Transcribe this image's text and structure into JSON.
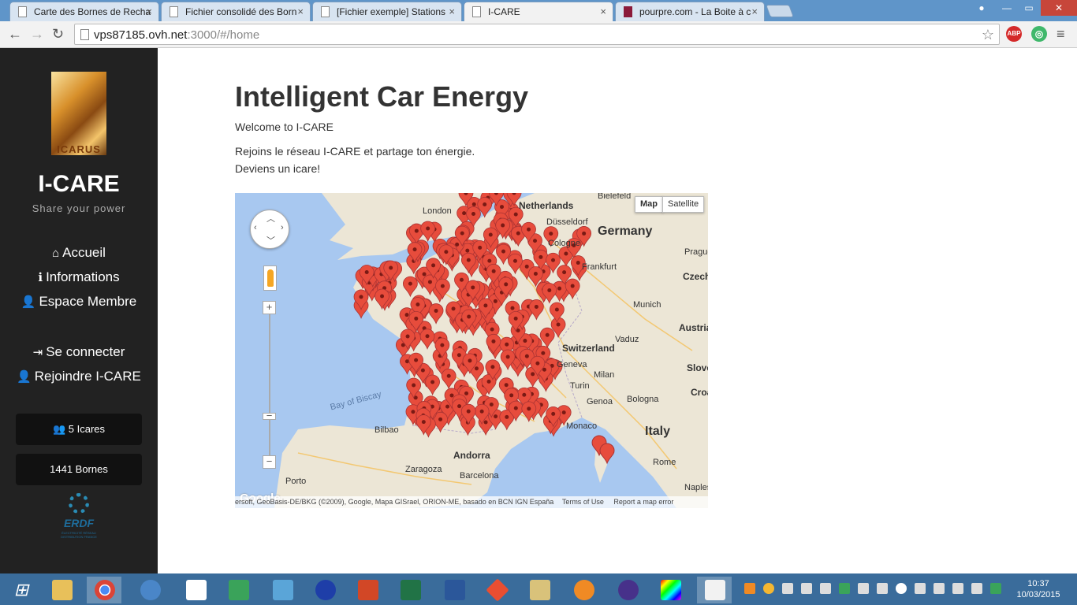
{
  "browser": {
    "tabs": [
      {
        "title": "Carte des Bornes de Recha",
        "active": false
      },
      {
        "title": "Fichier consolidé des Born",
        "active": false
      },
      {
        "title": "[Fichier exemple] Stations",
        "active": false
      },
      {
        "title": "I-CARE",
        "active": true
      },
      {
        "title": "pourpre.com - La Boite à c",
        "active": false
      }
    ],
    "tab_close": "×",
    "url_host": "vps87185.ovh.net",
    "url_rest": ":3000/#/home",
    "extensions": [
      "ABP"
    ]
  },
  "sidebar": {
    "logo_text": "ICARUS",
    "brand": "I-CARE",
    "tagline": "Share your power",
    "nav": [
      {
        "label": "Accueil",
        "icon": "home-icon",
        "glyph": "⌂"
      },
      {
        "label": "Informations",
        "icon": "info-icon",
        "glyph": "ℹ"
      },
      {
        "label": "Espace Membre",
        "icon": "user-icon",
        "glyph": "👤"
      },
      {
        "label": "Se connecter",
        "icon": "sign-in-icon",
        "glyph": "⇥"
      },
      {
        "label": "Rejoindre I-CARE",
        "icon": "user-plus-icon",
        "glyph": "👤"
      }
    ],
    "stats": [
      {
        "label": "5 Icares",
        "icon": "users-icon",
        "glyph": "👥"
      },
      {
        "label": "1441 Bornes"
      }
    ],
    "partner_logo": "ERDF",
    "partner_sub": "ÉLECTRICITÉ RÉSEAU DISTRIBUTION FRANCE"
  },
  "main": {
    "title": "Intelligent Car Energy",
    "welcome": "Welcome to I-CARE",
    "pitch_line1": "Rejoins le réseau I-CARE et partage ton énergie.",
    "pitch_line2": "Deviens un icare!"
  },
  "map": {
    "type_buttons": [
      "Map",
      "Satellite"
    ],
    "selected_type": "Map",
    "zoom_in": "+",
    "zoom_out": "−",
    "zoom_level_mark": "−",
    "attribution": "ersoft, GeoBasis-DE/BKG (©2009), Google, Mapa GISrael, ORION-ME, basado en BCN IGN España",
    "terms": "Terms of Use",
    "report": "Report a map error",
    "watermark": "Google",
    "place_labels": [
      {
        "text": "London",
        "style": "normal"
      },
      {
        "text": "Netherlands",
        "style": "bold"
      },
      {
        "text": "Bielefeld",
        "style": "normal"
      },
      {
        "text": "Düsseldorf",
        "style": "normal"
      },
      {
        "text": "Germany",
        "style": "big"
      },
      {
        "text": "Cologne",
        "style": "normal"
      },
      {
        "text": "Frankfurt",
        "style": "normal"
      },
      {
        "text": "Prague",
        "style": "normal"
      },
      {
        "text": "Czech",
        "style": "bold"
      },
      {
        "text": "Munich",
        "style": "normal"
      },
      {
        "text": "Austria",
        "style": "bold"
      },
      {
        "text": "Vaduz",
        "style": "normal"
      },
      {
        "text": "Switzerland",
        "style": "bold"
      },
      {
        "text": "Geneva",
        "style": "normal"
      },
      {
        "text": "Milan",
        "style": "normal"
      },
      {
        "text": "Slove",
        "style": "bold"
      },
      {
        "text": "Turin",
        "style": "normal"
      },
      {
        "text": "Croa",
        "style": "bold"
      },
      {
        "text": "Genoa",
        "style": "normal"
      },
      {
        "text": "Bologna",
        "style": "normal"
      },
      {
        "text": "Monaco",
        "style": "normal"
      },
      {
        "text": "Italy",
        "style": "big"
      },
      {
        "text": "Bay of Biscay",
        "style": "normal"
      },
      {
        "text": "Bilbao",
        "style": "normal"
      },
      {
        "text": "Andorra",
        "style": "bold"
      },
      {
        "text": "Zaragoza",
        "style": "normal"
      },
      {
        "text": "Barcelona",
        "style": "normal"
      },
      {
        "text": "Rome",
        "style": "normal"
      },
      {
        "text": "Porto",
        "style": "normal"
      },
      {
        "text": "Naples",
        "style": "normal"
      }
    ]
  },
  "taskbar": {
    "time": "10:37",
    "date": "10/03/2015",
    "apps": [
      "start",
      "file-explorer",
      "chrome",
      "thunderbird",
      "dropbox",
      "notepad",
      "vim",
      "vpn",
      "powerpoint",
      "excel",
      "word",
      "git",
      "java",
      "blender",
      "eclipse",
      "color-picker",
      "paint"
    ]
  },
  "colors": {
    "sidebar_bg": "#222222",
    "marker": "#e74c3c",
    "sea": "#a8c8f0",
    "land": "#ece6d6",
    "taskbar": "#3a6c9b"
  }
}
